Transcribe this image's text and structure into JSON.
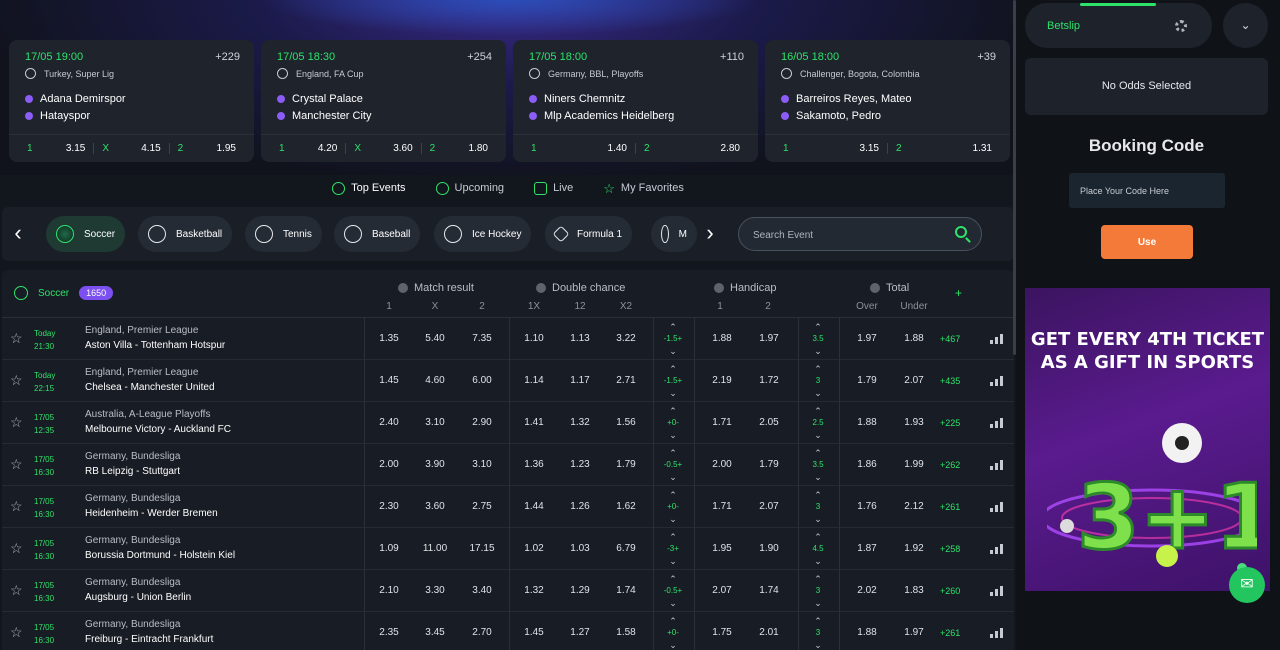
{
  "featured": [
    {
      "date": "17/05  19:00",
      "more": "+229",
      "league": "Turkey, Super Lig",
      "team1": "Adana Demirspor",
      "team2": "Hatayspor",
      "odds": [
        {
          "label": "1",
          "value": "3.15"
        },
        {
          "label": "X",
          "value": "4.15"
        },
        {
          "label": "2",
          "value": "1.95"
        }
      ]
    },
    {
      "date": "17/05  18:30",
      "more": "+254",
      "league": "England, FA Cup",
      "team1": "Crystal Palace",
      "team2": "Manchester City",
      "odds": [
        {
          "label": "1",
          "value": "4.20"
        },
        {
          "label": "X",
          "value": "3.60"
        },
        {
          "label": "2",
          "value": "1.80"
        }
      ]
    },
    {
      "date": "17/05  18:00",
      "more": "+110",
      "league": "Germany, BBL, Playoffs",
      "team1": "Niners Chemnitz",
      "team2": "Mlp Academics Heidelberg",
      "odds": [
        {
          "label": "1",
          "value": "1.40"
        },
        {
          "label": "2",
          "value": "2.80"
        }
      ]
    },
    {
      "date": "16/05  18:00",
      "more": "+39",
      "league": "Challenger, Bogota, Colombia",
      "team1": "Barreiros Reyes, Mateo",
      "team2": "Sakamoto, Pedro",
      "odds": [
        {
          "label": "1",
          "value": "3.15"
        },
        {
          "label": "2",
          "value": "1.31"
        }
      ]
    }
  ],
  "tabs": [
    "Top Events",
    "Upcoming",
    "Live",
    "My Favorites"
  ],
  "sports": [
    "Soccer",
    "Basketball",
    "Tennis",
    "Baseball",
    "Ice Hockey",
    "Formula 1",
    "M"
  ],
  "search": {
    "placeholder": "Search Event"
  },
  "table": {
    "sport": "Soccer",
    "count": "1650",
    "groups": {
      "match_result": "Match result",
      "double_chance": "Double chance",
      "handicap": "Handicap",
      "total": "Total"
    },
    "sub": {
      "m1": "1",
      "mx": "X",
      "m2": "2",
      "d1x": "1X",
      "d12": "12",
      "dx2": "X2",
      "h1": "1",
      "h2": "2",
      "over": "Over",
      "under": "Under"
    },
    "plus": "+",
    "rows": [
      {
        "day": "Today",
        "time": "21:30",
        "league": "England, Premier League",
        "teams": "Aston Villa  -  Tottenham Hotspur",
        "m": [
          "1.35",
          "5.40",
          "7.35"
        ],
        "d": [
          "1.10",
          "1.13",
          "3.22"
        ],
        "hc": "-1.5+",
        "h": [
          "1.88",
          "1.97"
        ],
        "tl": "3.5",
        "t": [
          "1.97",
          "1.88"
        ],
        "more": "+467"
      },
      {
        "day": "Today",
        "time": "22:15",
        "league": "England, Premier League",
        "teams": "Chelsea  -  Manchester United",
        "m": [
          "1.45",
          "4.60",
          "6.00"
        ],
        "d": [
          "1.14",
          "1.17",
          "2.71"
        ],
        "hc": "-1.5+",
        "h": [
          "2.19",
          "1.72"
        ],
        "tl": "3",
        "t": [
          "1.79",
          "2.07"
        ],
        "more": "+435"
      },
      {
        "day": "17/05",
        "time": "12:35",
        "league": "Australia, A-League Playoffs",
        "teams": "Melbourne Victory  -  Auckland FC",
        "m": [
          "2.40",
          "3.10",
          "2.90"
        ],
        "d": [
          "1.41",
          "1.32",
          "1.56"
        ],
        "hc": "+0-",
        "h": [
          "1.71",
          "2.05"
        ],
        "tl": "2.5",
        "t": [
          "1.88",
          "1.93"
        ],
        "more": "+225"
      },
      {
        "day": "17/05",
        "time": "16:30",
        "league": "Germany, Bundesliga",
        "teams": "RB Leipzig  -  Stuttgart",
        "m": [
          "2.00",
          "3.90",
          "3.10"
        ],
        "d": [
          "1.36",
          "1.23",
          "1.79"
        ],
        "hc": "-0.5+",
        "h": [
          "2.00",
          "1.79"
        ],
        "tl": "3.5",
        "t": [
          "1.86",
          "1.99"
        ],
        "more": "+262"
      },
      {
        "day": "17/05",
        "time": "16:30",
        "league": "Germany, Bundesliga",
        "teams": "Heidenheim  -  Werder Bremen",
        "m": [
          "2.30",
          "3.60",
          "2.75"
        ],
        "d": [
          "1.44",
          "1.26",
          "1.62"
        ],
        "hc": "+0-",
        "h": [
          "1.71",
          "2.07"
        ],
        "tl": "3",
        "t": [
          "1.76",
          "2.12"
        ],
        "more": "+261"
      },
      {
        "day": "17/05",
        "time": "16:30",
        "league": "Germany, Bundesliga",
        "teams": "Borussia Dortmund  -  Holstein Kiel",
        "m": [
          "1.09",
          "11.00",
          "17.15"
        ],
        "d": [
          "1.02",
          "1.03",
          "6.79"
        ],
        "hc": "-3+",
        "h": [
          "1.95",
          "1.90"
        ],
        "tl": "4.5",
        "t": [
          "1.87",
          "1.92"
        ],
        "more": "+258"
      },
      {
        "day": "17/05",
        "time": "16:30",
        "league": "Germany, Bundesliga",
        "teams": "Augsburg  -  Union Berlin",
        "m": [
          "2.10",
          "3.30",
          "3.40"
        ],
        "d": [
          "1.32",
          "1.29",
          "1.74"
        ],
        "hc": "-0.5+",
        "h": [
          "2.07",
          "1.74"
        ],
        "tl": "3",
        "t": [
          "2.02",
          "1.83"
        ],
        "more": "+260"
      },
      {
        "day": "17/05",
        "time": "16:30",
        "league": "Germany, Bundesliga",
        "teams": "Freiburg  -  Eintracht Frankfurt",
        "m": [
          "2.35",
          "3.45",
          "2.70"
        ],
        "d": [
          "1.45",
          "1.27",
          "1.58"
        ],
        "hc": "+0-",
        "h": [
          "1.75",
          "2.01"
        ],
        "tl": "3",
        "t": [
          "1.88",
          "1.97"
        ],
        "more": "+261"
      }
    ]
  },
  "sidebar": {
    "betslip": "Betslip",
    "no_odds": "No Odds Selected",
    "booking_title": "Booking Code",
    "code_placeholder": "Place Your Code Here",
    "use": "Use",
    "promo_line1": "GET EVERY 4TH TICKET",
    "promo_line2": "AS A GIFT IN SPORTS",
    "promo_number": "3+1"
  },
  "colors": {
    "accent": "#2ee36a",
    "badge": "#7b4ff0",
    "use_button": "#f47a3a"
  }
}
